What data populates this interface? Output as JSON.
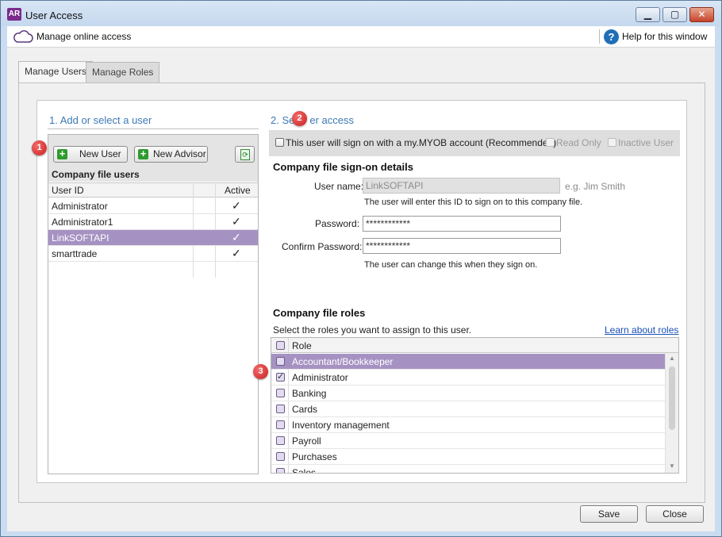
{
  "window": {
    "app_icon": "AR",
    "title": "User Access",
    "controls": [
      "minimize-icon",
      "maximize-icon",
      "close-icon"
    ]
  },
  "topbar": {
    "title": "Manage online access",
    "help_label": "Help for this window",
    "help_icon": "?"
  },
  "tabs": [
    {
      "label": "Manage Users",
      "active": true
    },
    {
      "label": "Manage Roles",
      "active": false
    }
  ],
  "left": {
    "heading": "1. Add or select a user",
    "new_user_label": "New User",
    "new_advisor_label": "New Advisor",
    "refresh_glyph": "⟳",
    "list_caption": "Company file users",
    "columns": [
      "User ID",
      "Active"
    ],
    "users": [
      {
        "id": "Administrator",
        "active": "✓",
        "selected": false
      },
      {
        "id": "Administrator1",
        "active": "✓",
        "selected": false
      },
      {
        "id": "LinkSOFTAPI",
        "active": "✓",
        "selected": true
      },
      {
        "id": "smarttrade",
        "active": "✓",
        "selected": false
      }
    ]
  },
  "right": {
    "heading_start": "2. Se",
    "heading_end": "er access",
    "myob_label": "This user will sign on with a my.MYOB account (Recommended)",
    "readonly_label": "Read Only",
    "inactive_label": "Inactive User",
    "signon_title": "Company file sign-on details",
    "username_label": "User name:",
    "username_value": "LinkSOFTAPI",
    "username_example": "e.g. Jim Smith",
    "username_hint": "The user will enter this ID to sign on to this company file.",
    "password_label": "Password:",
    "password_value": "************",
    "confirm_label": "Confirm Password:",
    "confirm_value": "************",
    "password_hint": "The user can change this when they sign on.",
    "roles_title": "Company file roles",
    "roles_hint": "Select the roles you want to assign to this user.",
    "roles_link": "Learn about roles",
    "roles_column": "Role",
    "roles": [
      {
        "name": "Accountant/Bookkeeper",
        "checked": false,
        "selected": true
      },
      {
        "name": "Administrator",
        "checked": true,
        "selected": false
      },
      {
        "name": "Banking",
        "checked": false,
        "selected": false
      },
      {
        "name": "Cards",
        "checked": false,
        "selected": false
      },
      {
        "name": "Inventory management",
        "checked": false,
        "selected": false
      },
      {
        "name": "Payroll",
        "checked": false,
        "selected": false
      },
      {
        "name": "Purchases",
        "checked": false,
        "selected": false
      },
      {
        "name": "Sales",
        "checked": false,
        "selected": false
      }
    ]
  },
  "annotations": [
    "1",
    "2",
    "3"
  ],
  "footer": {
    "save_label": "Save",
    "close_label": "Close"
  },
  "colors": {
    "selection": "#a692c2",
    "heading_blue": "#3c79b5",
    "badge_red": "#d42a2a"
  }
}
